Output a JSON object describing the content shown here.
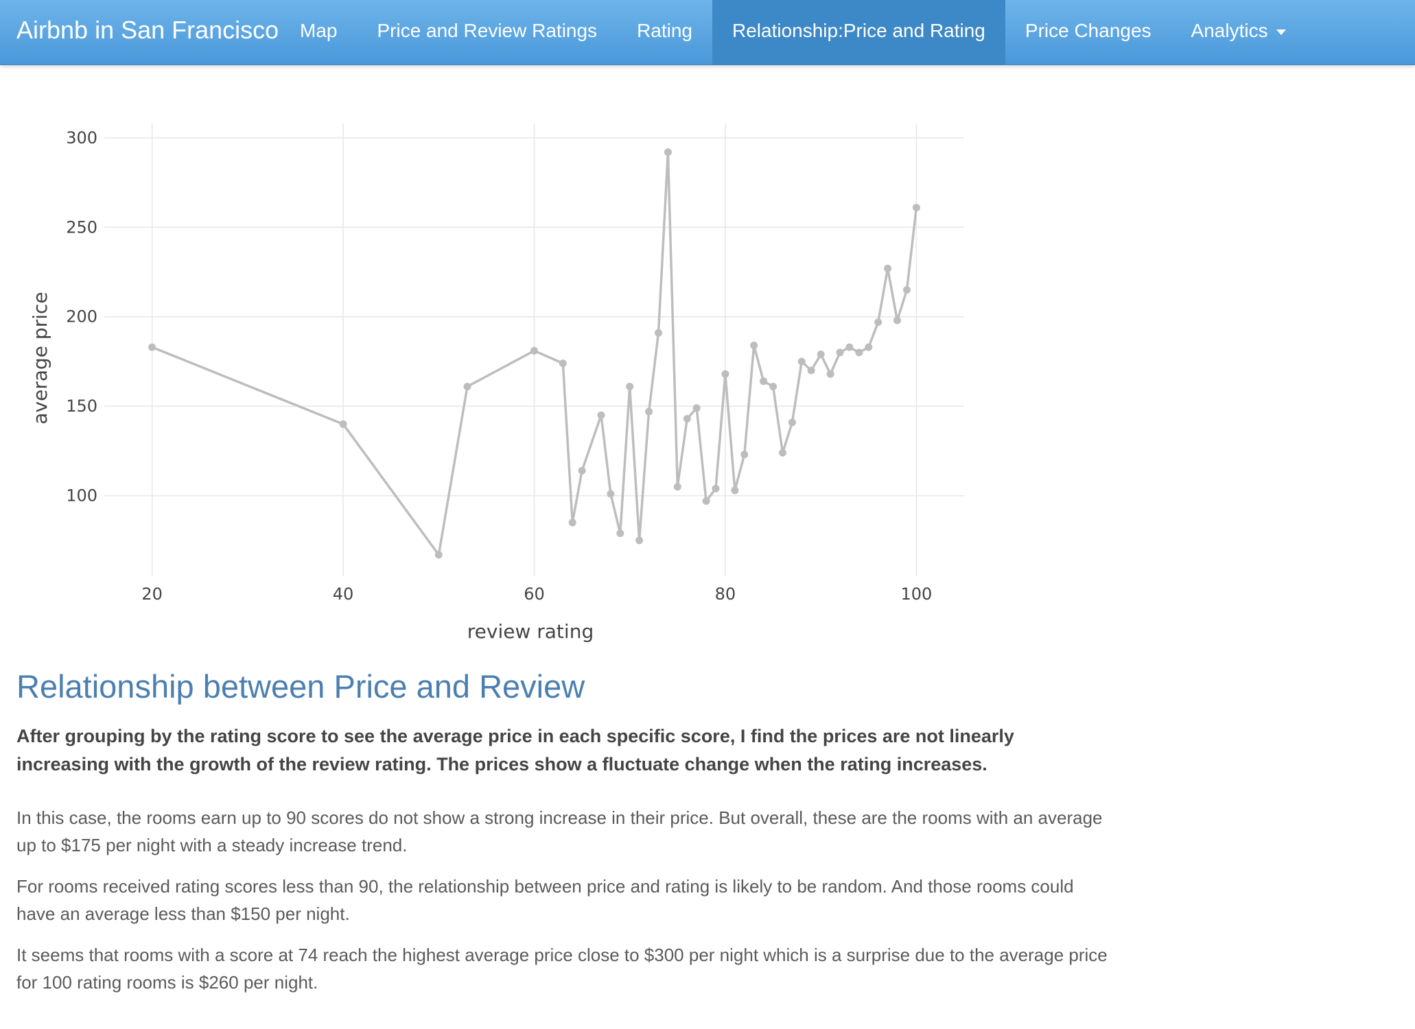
{
  "navbar": {
    "brand": "Airbnb in San Francisco",
    "items": [
      {
        "label": "Map",
        "active": false
      },
      {
        "label": "Price and Review Ratings",
        "active": false
      },
      {
        "label": "Rating",
        "active": false
      },
      {
        "label": "Relationship:Price and Rating",
        "active": true
      },
      {
        "label": "Price Changes",
        "active": false
      },
      {
        "label": "Analytics",
        "active": false,
        "dropdown": true
      }
    ],
    "dropdown_icon": "caret-down-icon",
    "color": "#5aa5e3",
    "active_color": "#3d88c6"
  },
  "chart_data": {
    "type": "line",
    "title": "",
    "xlabel": "review rating",
    "ylabel": "average price",
    "xlim": [
      15,
      105
    ],
    "ylim": [
      55,
      308
    ],
    "xticks": [
      20,
      40,
      60,
      80,
      100
    ],
    "yticks": [
      100,
      150,
      200,
      250,
      300
    ],
    "grid": true,
    "line_color": "#bdbdbd",
    "series": [
      {
        "x": [
          20,
          40,
          50,
          53,
          60,
          63,
          64,
          65,
          67,
          68,
          69,
          70,
          71,
          72,
          73,
          74,
          75,
          76,
          77,
          78,
          79,
          80,
          81,
          82,
          83,
          84,
          85,
          86,
          87,
          88,
          89,
          90,
          91,
          92,
          93,
          94,
          95,
          96,
          97,
          98,
          99,
          100
        ],
        "y": [
          183,
          140,
          67,
          161,
          181,
          174,
          85,
          114,
          145,
          101,
          79,
          161,
          75,
          147,
          191,
          292,
          105,
          143,
          149,
          97,
          104,
          168,
          103,
          123,
          184,
          164,
          161,
          124,
          141,
          175,
          170,
          179,
          168,
          180,
          183,
          180,
          183,
          197,
          227,
          198,
          215,
          261
        ]
      }
    ]
  },
  "content": {
    "heading": "Relationship between Price and Review",
    "lead": "After grouping by the rating score to see the average price in each specific score, I find the prices are not linearly increasing with the growth of the review rating. The prices show a fluctuate change when the rating increases.",
    "p1": "In this case, the rooms earn up to 90 scores do not show a strong increase in their price. But overall, these are the rooms with an average up to $175 per night with a steady increase trend.",
    "p2": "For rooms received rating scores less than 90, the relationship between price and rating is likely to be random. And those rooms could have an average less than $150 per night.",
    "p3": "It seems that rooms with a score at 74 reach the highest average price close to $300 per night which is a surprise due to the average price for 100 rating rooms is $260 per night."
  }
}
